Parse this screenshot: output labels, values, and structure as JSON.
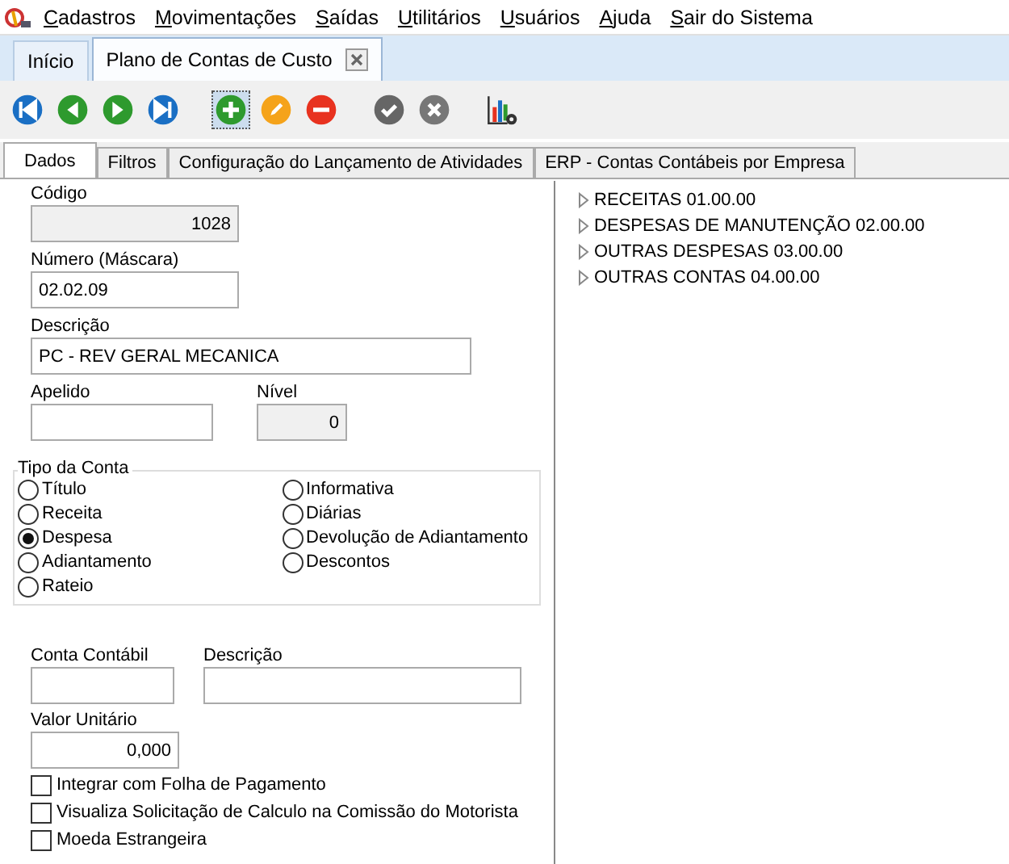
{
  "menu": [
    {
      "label": "Cadastros"
    },
    {
      "label": "Movimentações"
    },
    {
      "label": "Saídas"
    },
    {
      "label": "Utilitários"
    },
    {
      "label": "Usuários"
    },
    {
      "label": "Ajuda"
    },
    {
      "label": "Sair do Sistema"
    }
  ],
  "window_tabs": [
    {
      "label": "Início",
      "selected": false,
      "closable": false
    },
    {
      "label": "Plano de Contas de Custo",
      "selected": true,
      "closable": true
    }
  ],
  "toolbar": [
    {
      "kind": "first"
    },
    {
      "kind": "prev"
    },
    {
      "kind": "next"
    },
    {
      "kind": "last"
    },
    {
      "kind": "add",
      "focused": true
    },
    {
      "kind": "edit"
    },
    {
      "kind": "delete"
    },
    {
      "kind": "confirm"
    },
    {
      "kind": "cancel"
    },
    {
      "kind": "report"
    }
  ],
  "form_tabs": [
    {
      "label": "Dados",
      "selected": true
    },
    {
      "label": "Filtros",
      "selected": false
    },
    {
      "label": "Configuração do Lançamento de Atividades",
      "selected": false
    },
    {
      "label": "ERP - Contas Contábeis por Empresa",
      "selected": false
    }
  ],
  "fields": {
    "codigo": {
      "label": "Código",
      "value": "1028"
    },
    "numero": {
      "label": "Número (Máscara)",
      "value": "02.02.09"
    },
    "descricao": {
      "label": "Descrição",
      "value": "PC - REV GERAL MECANICA"
    },
    "apelido": {
      "label": "Apelido"
    },
    "nivel": {
      "label": "Nível",
      "value": "0"
    }
  },
  "tipo_conta": {
    "title": "Tipo da Conta",
    "columns": [
      [
        {
          "label": "Título",
          "selected": false
        },
        {
          "label": "Receita",
          "selected": false
        },
        {
          "label": "Despesa",
          "selected": true
        },
        {
          "label": "Adiantamento",
          "selected": false
        },
        {
          "label": "Rateio",
          "selected": false
        }
      ],
      [
        {
          "label": "Informativa",
          "selected": false
        },
        {
          "label": "Diárias",
          "selected": false
        },
        {
          "label": "Devolução de Adiantamento",
          "selected": false
        },
        {
          "label": "Descontos",
          "selected": false
        }
      ]
    ]
  },
  "conta_contabil": {
    "label": "Conta Contábil"
  },
  "conta_descricao": {
    "label": "Descrição"
  },
  "valor_unitario": {
    "label": "Valor Unitário",
    "value": "0,000"
  },
  "checkboxes": [
    {
      "label": "Integrar com Folha de Pagamento",
      "checked": false
    },
    {
      "label": "Visualiza Solicitação de Calculo na Comissão do Motorista",
      "checked": false
    },
    {
      "label": "Moeda Estrangeira",
      "checked": false
    }
  ],
  "tree": [
    {
      "label": "RECEITAS 01.00.00",
      "expanded": false
    },
    {
      "label": "DESPESAS DE MANUTENÇÃO 02.00.00",
      "expanded": false
    },
    {
      "label": "OUTRAS DESPESAS 03.00.00",
      "expanded": false
    },
    {
      "label": "OUTRAS CONTAS 04.00.00",
      "expanded": false
    }
  ]
}
